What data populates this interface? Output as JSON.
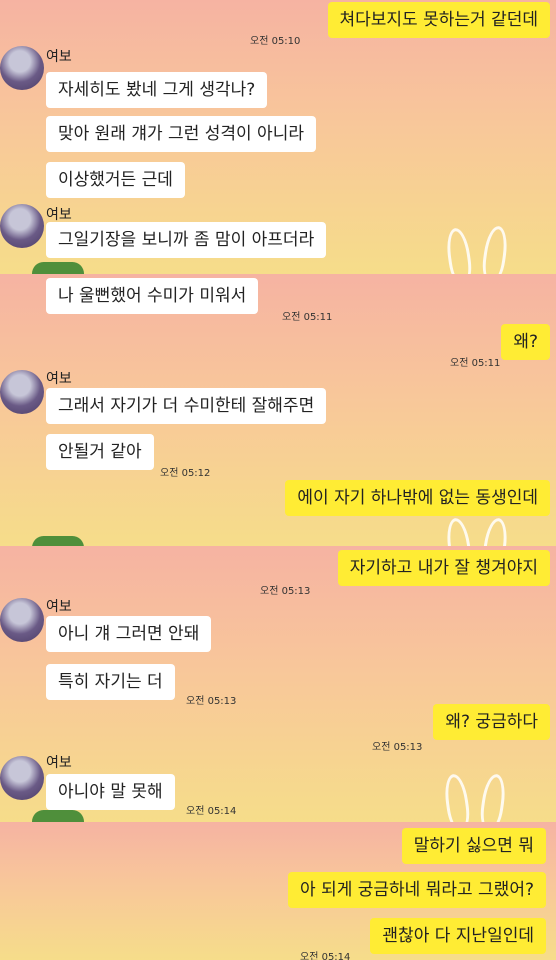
{
  "sender_name": "여보",
  "messages": [
    {
      "text": "쳐다보지도 못하는거 같던데",
      "time": "오전 05:10"
    },
    {
      "text": "자세히도 봤네 그게 생각나?"
    },
    {
      "text": "맞아 원래 걔가 그런 성격이 아니라"
    },
    {
      "text": "이상했거든 근데"
    },
    {
      "text": "그일기장을 보니까 좀 맘이 아프더라"
    },
    {
      "text": "나 울뻔했어 수미가 미워서",
      "time": "오전 05:11"
    },
    {
      "text": "왜?",
      "time": "오전 05:11"
    },
    {
      "text": "그래서 자기가 더 수미한테 잘해주면"
    },
    {
      "text": "안될거 같아",
      "time": "오전 05:12"
    },
    {
      "text": "에이 자기 하나밖에 없는 동생인데"
    },
    {
      "text": "자기하고 내가 잘 챙겨야지",
      "time": "오전 05:13"
    },
    {
      "text": "아니 걔 그러면 안돼"
    },
    {
      "text": "특히 자기는 더",
      "time": "오전 05:13"
    },
    {
      "text": "왜? 궁금하다",
      "time": "오전 05:13"
    },
    {
      "text": "아니야 말 못해",
      "time": "오전 05:14"
    },
    {
      "text": "말하기 싫으면 뭐"
    },
    {
      "text": "아 되게 궁금하네 뭐라고 그랬어?"
    },
    {
      "text": "괜찮아 다 지난일인데",
      "time": "오전 05:14"
    }
  ]
}
